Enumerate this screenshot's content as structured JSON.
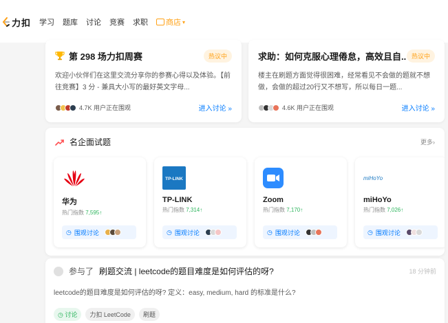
{
  "nav": {
    "logo_text": "力扣",
    "links": [
      "学习",
      "题库",
      "讨论",
      "竞赛",
      "求职"
    ],
    "store_label": "商店"
  },
  "posts": [
    {
      "title": "第 298 场力扣周赛",
      "badge": "热议中",
      "desc": "欢迎小伙伴们在这里交流分享你的参赛心得以及体验。【前往竞赛】3 分 - 兼具大小写的最好英文字母...",
      "watch": "4.7K 用户正在围观",
      "link": "进入讨论 »"
    },
    {
      "title": "求助：如何克服心理倦怠，高效且自...",
      "badge": "热议中",
      "desc": "楼主在刷题方面觉得很困难，经常看见不会做的题就不想做，会做的超过20行又不想写，所以每日一题...",
      "watch": "4.6K 用户正在围观",
      "link": "进入讨论 »"
    }
  ],
  "companies_panel": {
    "title": "名企面试题",
    "more": "更多›",
    "hot_label": "热门指数",
    "btn_label": "围观讨论",
    "items": [
      {
        "name": "华为",
        "hot": "7,595↑"
      },
      {
        "name": "TP-LINK",
        "hot": "7,314↑"
      },
      {
        "name": "Zoom",
        "hot": "7,170↑"
      },
      {
        "name": "miHoYo",
        "hot": "7,026↑"
      }
    ]
  },
  "discussion": {
    "prefix": "参与了",
    "title": "刷题交流 | leetcode的题目难度是如何评估的呀?",
    "time": "18 分钟前",
    "desc": "leetcode的题目难度是如何评估的呀?  定义：easy, medium, hard 的标准是什么?",
    "tags": [
      "讨论",
      "力扣 LeetCode",
      "刷题"
    ]
  },
  "colors": {
    "accent": "#ffa116",
    "link": "#007aff",
    "green": "#2db55d",
    "huawei": "#e60012",
    "tplink": "#1b78c2",
    "zoom": "#2d8cff"
  }
}
